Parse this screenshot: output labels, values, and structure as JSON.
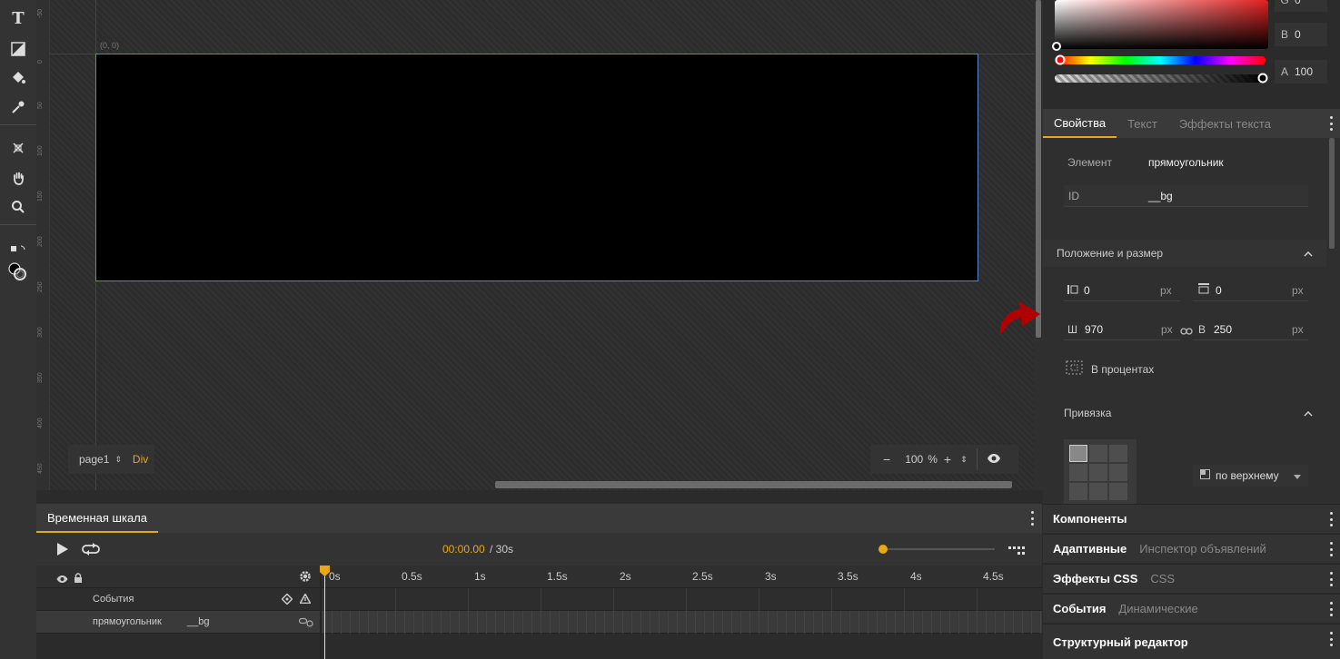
{
  "canvas": {
    "origin_label": "(0, 0)",
    "ruler_ticks": [
      "-50",
      "0",
      "50",
      "100",
      "150",
      "200",
      "250",
      "300",
      "350",
      "400",
      "450"
    ],
    "page_selector": {
      "page": "page1",
      "type": "Div"
    },
    "zoom": {
      "value": "100",
      "unit": "%"
    }
  },
  "color_picker": {
    "fields": [
      {
        "label": "G",
        "value": "0"
      },
      {
        "label": "B",
        "value": "0"
      },
      {
        "label": "A",
        "value": "100"
      }
    ]
  },
  "props": {
    "tabs": [
      "Свойства",
      "Текст",
      "Эффекты текста"
    ],
    "element_label": "Элемент",
    "element_value": "прямоугольник",
    "id_label": "ID",
    "id_value": "__bg",
    "position_section": "Положение и размер",
    "x": {
      "value": "0",
      "unit": "px"
    },
    "y": {
      "value": "0",
      "unit": "px"
    },
    "w": {
      "label": "Ш",
      "value": "970",
      "unit": "px"
    },
    "h": {
      "label": "В",
      "value": "250",
      "unit": "px"
    },
    "percent_label": "В процентах",
    "anchor_section": "Привязка",
    "anchor_select": "по верхнему"
  },
  "timeline": {
    "tab": "Временная шкала",
    "time": "00:00.00",
    "duration": "/ 30s",
    "ticks": [
      "0s",
      "0.5s",
      "1s",
      "1.5s",
      "2s",
      "2.5s",
      "3s",
      "3.5s",
      "4s",
      "4.5s"
    ],
    "rows": [
      {
        "name": "События",
        "id": ""
      },
      {
        "name": "прямоугольник",
        "id": "__bg"
      }
    ]
  },
  "right_panels": [
    {
      "a": "Компоненты",
      "b": ""
    },
    {
      "a": "Адаптивные",
      "b": "Инспектор объявлений"
    },
    {
      "a": "Эффекты CSS",
      "b": "CSS"
    },
    {
      "a": "События",
      "b": "Динамические"
    },
    {
      "a": "Структурный редактор",
      "b": ""
    }
  ],
  "colors": {
    "accent": "#e6a817",
    "selection": "#5c82c8",
    "annotation_arrow": "#b00000"
  }
}
